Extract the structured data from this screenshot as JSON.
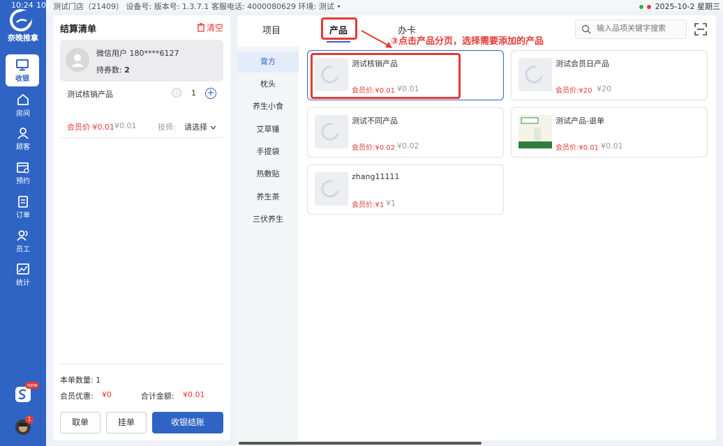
{
  "status_bar": {
    "time": "10:24",
    "time_cont": "10",
    "info": "测试门店（21409）    设备号:  版本号:  1.3.7.1  客服电话:  4000080629  环境:  测试 •",
    "right": "2025-10-2  星期三"
  },
  "sidebar": {
    "logo_text": "奈晚推拿",
    "items": [
      {
        "label": "收银",
        "icon": "monitor-icon"
      },
      {
        "label": "房间",
        "icon": "home-icon"
      },
      {
        "label": "顾客",
        "icon": "user-icon"
      },
      {
        "label": "预约",
        "icon": "calendar-icon"
      },
      {
        "label": "订单",
        "icon": "clipboard-icon"
      },
      {
        "label": "员工",
        "icon": "staff-icon"
      },
      {
        "label": "统计",
        "icon": "chart-icon"
      }
    ],
    "new_badge": "new",
    "notify_count": "1"
  },
  "settlement": {
    "title": "结算清单",
    "clear": "清空",
    "member_name": "微信用户 180****6127",
    "coupon_label": "持券数:",
    "coupon_count": "2",
    "item": {
      "name": "测试核销产品",
      "qty": "1",
      "price": "会员价  ¥0.01",
      "orig": "¥0.01",
      "tech_label": "技师:",
      "tech_select": "请选择"
    },
    "count_label": "本单数量:  1",
    "discount_label": "会员优惠:",
    "discount_value": "¥0",
    "total_label": "合计金额:",
    "total_value": "¥0.01",
    "buttons": {
      "take": "取单",
      "hang": "挂单",
      "checkout": "收银结账"
    }
  },
  "main": {
    "tabs": [
      "项目",
      "产品",
      "办卡"
    ],
    "active_tab": "产品",
    "search_placeholder": "输入品项关键字搜索",
    "categories": [
      "膏方",
      "枕头",
      "养生小食",
      "艾草锤",
      "手提袋",
      "热敷贴",
      "养生茶",
      "三伏养生"
    ],
    "active_category": "膏方",
    "products": [
      {
        "name": "测试核销产品",
        "member_price": "会员价:¥0.01",
        "orig": "¥0.01"
      },
      {
        "name": "测试会员日产品",
        "member_price": "会员价:¥20",
        "orig": "¥20"
      },
      {
        "name": "测试不同产品",
        "member_price": "会员价:¥0.02",
        "orig": "¥0.02"
      },
      {
        "name": "测试产品-退单",
        "member_price": "会员价:¥0.01",
        "orig": "¥0.01"
      },
      {
        "name": "zhang11111",
        "member_price": "会员价:¥1",
        "orig": "¥1"
      }
    ]
  },
  "annotation": {
    "text": "③点击产品分页，选择需要添加的产品",
    "color": "#e53935"
  },
  "colors": {
    "brand": "#2f64c5",
    "price": "#e53935"
  }
}
